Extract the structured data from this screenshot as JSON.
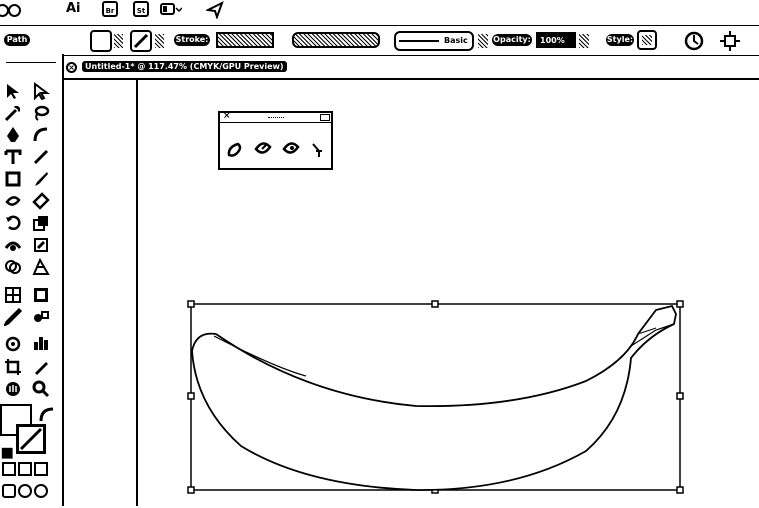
{
  "appbar": {
    "app_logo": "Ai",
    "bridge_label": "Br",
    "stock_label": "St"
  },
  "control": {
    "selection_type": "Path",
    "stroke_label": "Stroke:",
    "brush_label": "Basic",
    "opacity_label": "Opacity:",
    "opacity_value": "100%",
    "style_label": "Style:"
  },
  "document": {
    "tab_title": "Untitled-1* @ 117.47% (CMYK/GPU Preview)"
  },
  "colors": {
    "fill": "#ffffff",
    "stroke": "#000000"
  }
}
